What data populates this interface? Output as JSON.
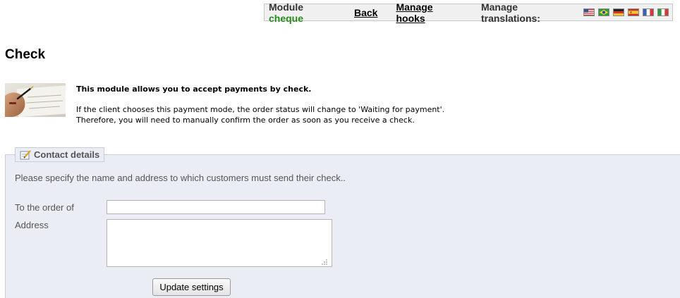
{
  "toolbar": {
    "module_label": "Module",
    "module_name": "cheque",
    "back_label": "Back",
    "manage_hooks_label": "Manage hooks",
    "manage_translations_label": "Manage translations:",
    "flags": [
      "us-flag-icon",
      "br-flag-icon",
      "de-flag-icon",
      "es-flag-icon",
      "fr-flag-icon",
      "it-flag-icon"
    ],
    "module_name_color": "#268c1c"
  },
  "page": {
    "title": "Check"
  },
  "description": {
    "image": "check-writing-photo",
    "headline": "This module allows you to accept payments by check.",
    "line1": "If the client chooses this payment mode, the order status will change to 'Waiting for payment'.",
    "line2": "Therefore, you will need to manually confirm the order as soon as you receive a check."
  },
  "contact": {
    "legend": "Contact details",
    "legend_icon": "edit-note-icon",
    "instructions": "Please specify the name and address to which customers must send their check..",
    "order_label": "To the order of",
    "order_value": "",
    "address_label": "Address",
    "address_value": "",
    "submit_label": "Update settings"
  },
  "colors": {
    "fieldset_bg": "#ebedf4",
    "toolbar_bg": "#f0f0f0"
  }
}
